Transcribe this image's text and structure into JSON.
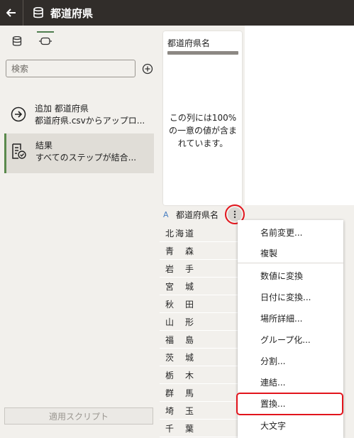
{
  "header": {
    "title": "都道府県"
  },
  "left_panel": {
    "search": {
      "placeholder": "検索"
    },
    "steps": [
      {
        "title": "追加 都道府県",
        "subtitle": "都道府県.csvからアップロ..."
      },
      {
        "title": "結果",
        "subtitle": "すべてのステップが結合..."
      }
    ],
    "apply_script_label": "適用スクリプト"
  },
  "profile_card": {
    "column_name": "都道府県名",
    "description": "この列には100%の一意の値が含まれています。"
  },
  "column": {
    "type_icon": "A",
    "name": "都道府県名",
    "values": [
      "北海道",
      "青　森",
      "岩　手",
      "宮　城",
      "秋　田",
      "山　形",
      "福　島",
      "茨　城",
      "栃　木",
      "群　馬",
      "埼　玉",
      "千　葉"
    ]
  },
  "context_menu": {
    "items": [
      "名前変更...",
      "複製",
      "数値に変換",
      "日付に変換...",
      "場所詳細...",
      "グループ化...",
      "分割...",
      "連結...",
      "置換...",
      "大文字"
    ],
    "highlighted": "置換..."
  },
  "colors": {
    "accent": "#5a8a4c",
    "highlight": "#e2141c",
    "header_bg": "#312d2a"
  }
}
